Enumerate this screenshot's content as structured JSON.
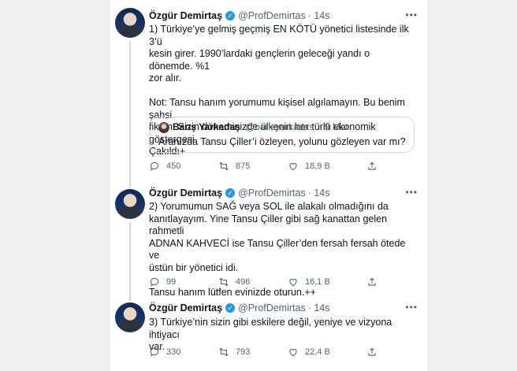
{
  "tweets": [
    {
      "author": "Özgür Demirtaş",
      "handle": "@ProfDemirtas",
      "time": "· 14s",
      "text": "1) Türkiye’ye gelmiş geçmiş EN KÖTÜ yönetici listesinde ilk 3’ü\nkesin girer. 1990’lardaki gençlerin geleceği yandı o dönemde. %1\nzor alır.\n\nNot: Tansu hanım yorumumu kişisel algılamayın. Bu benim şahsi\nfikrim. Sizin döneminizde ülkenin her türlü ekonomik göstergesi\nÇakıldı+",
      "quote": {
        "author": "Barış Yarkadaş",
        "handle": "@barisyarkadas",
        "time": "· 9 Mar",
        "text": "Aranızda Tansu Çiller’i özleyen, yolunu gözleyen var mı?"
      },
      "replies": "450",
      "retweets": "875",
      "likes": "18,9 B"
    },
    {
      "author": "Özgür Demirtaş",
      "handle": "@ProfDemirtas",
      "time": "· 14s",
      "text": "2) Yorumumun SAĞ veya SOL ile alakalı olmadığını da\nkanıtlayayım. Yine Tansu Çiller gibi sağ kanattan gelen rahmetli\nADNAN KAHVECİ ise Tansu Çiller’den fersah fersah ötede ve\nüstün bir yönetici idi.\n\nTansu hanım lütfen evinizde oturun.++",
      "replies": "99",
      "retweets": "496",
      "likes": "16,1 B"
    },
    {
      "author": "Özgür Demirtaş",
      "handle": "@ProfDemirtas",
      "time": "· 14s",
      "text": "3) Türkiye’nin sizin gibi eskilere değil, yeniye ve vizyona ihtiyacı\nvar.",
      "replies": "330",
      "retweets": "793",
      "likes": "22,4 B"
    }
  ],
  "icons": {
    "verified": "verified-badge-icon",
    "more": "more-options-icon",
    "reply": "reply-icon",
    "retweet": "retweet-icon",
    "like": "like-icon",
    "share": "share-icon"
  },
  "colors": {
    "accent": "#1d9bf0",
    "muted": "#536471",
    "border": "#cfd9de"
  }
}
